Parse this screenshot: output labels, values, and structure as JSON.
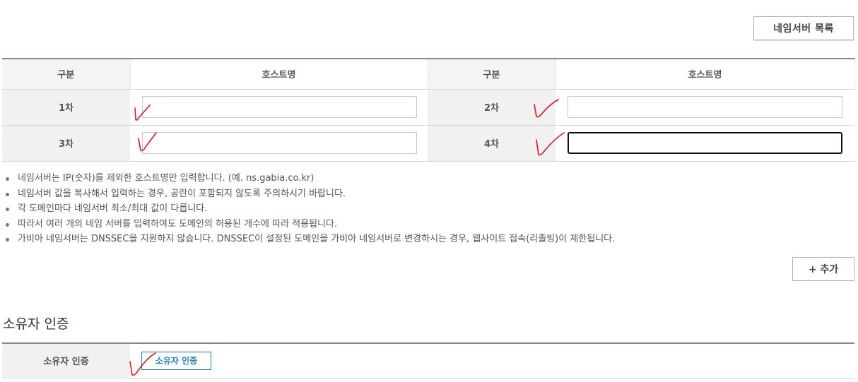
{
  "header": {
    "nameserver_list_button": "네임서버 목록"
  },
  "table": {
    "headers": [
      "구분",
      "호스트명",
      "구분",
      "호스트명"
    ],
    "rows": [
      {
        "left_label": "1차",
        "left_value": "",
        "right_label": "2차",
        "right_value": ""
      },
      {
        "left_label": "3차",
        "left_value": "",
        "right_label": "4차",
        "right_value": ""
      }
    ]
  },
  "notes": [
    "네임서버는 IP(숫자)를 제외한 호스트명만 입력합니다. (예. ns.gabia.co.kr)",
    "네임서버 값을 복사해서 입력하는 경우, 공란이 포함되지 않도록 주의하시기 바랍니다.",
    "각 도메인마다 네임서버 최소/최대 값이 다릅니다.",
    "따라서 여러 개의 네임 서버를 입력하여도 도메인의 허용된 개수에 따라 적용됩니다.",
    "가비아 네임서버는 DNSSEC을 지원하지 않습니다. DNSSEC이 설정된 도메인을 가비아 네임서버로 변경하시는 경우, 웹사이트 접속(리졸빙)이 제한됩니다."
  ],
  "add_button": "+ 추가",
  "owner": {
    "section_title": "소유자 인증",
    "row_label": "소유자 인증",
    "button_label": "소유자 인증"
  },
  "annotation_color": "#e8141a"
}
